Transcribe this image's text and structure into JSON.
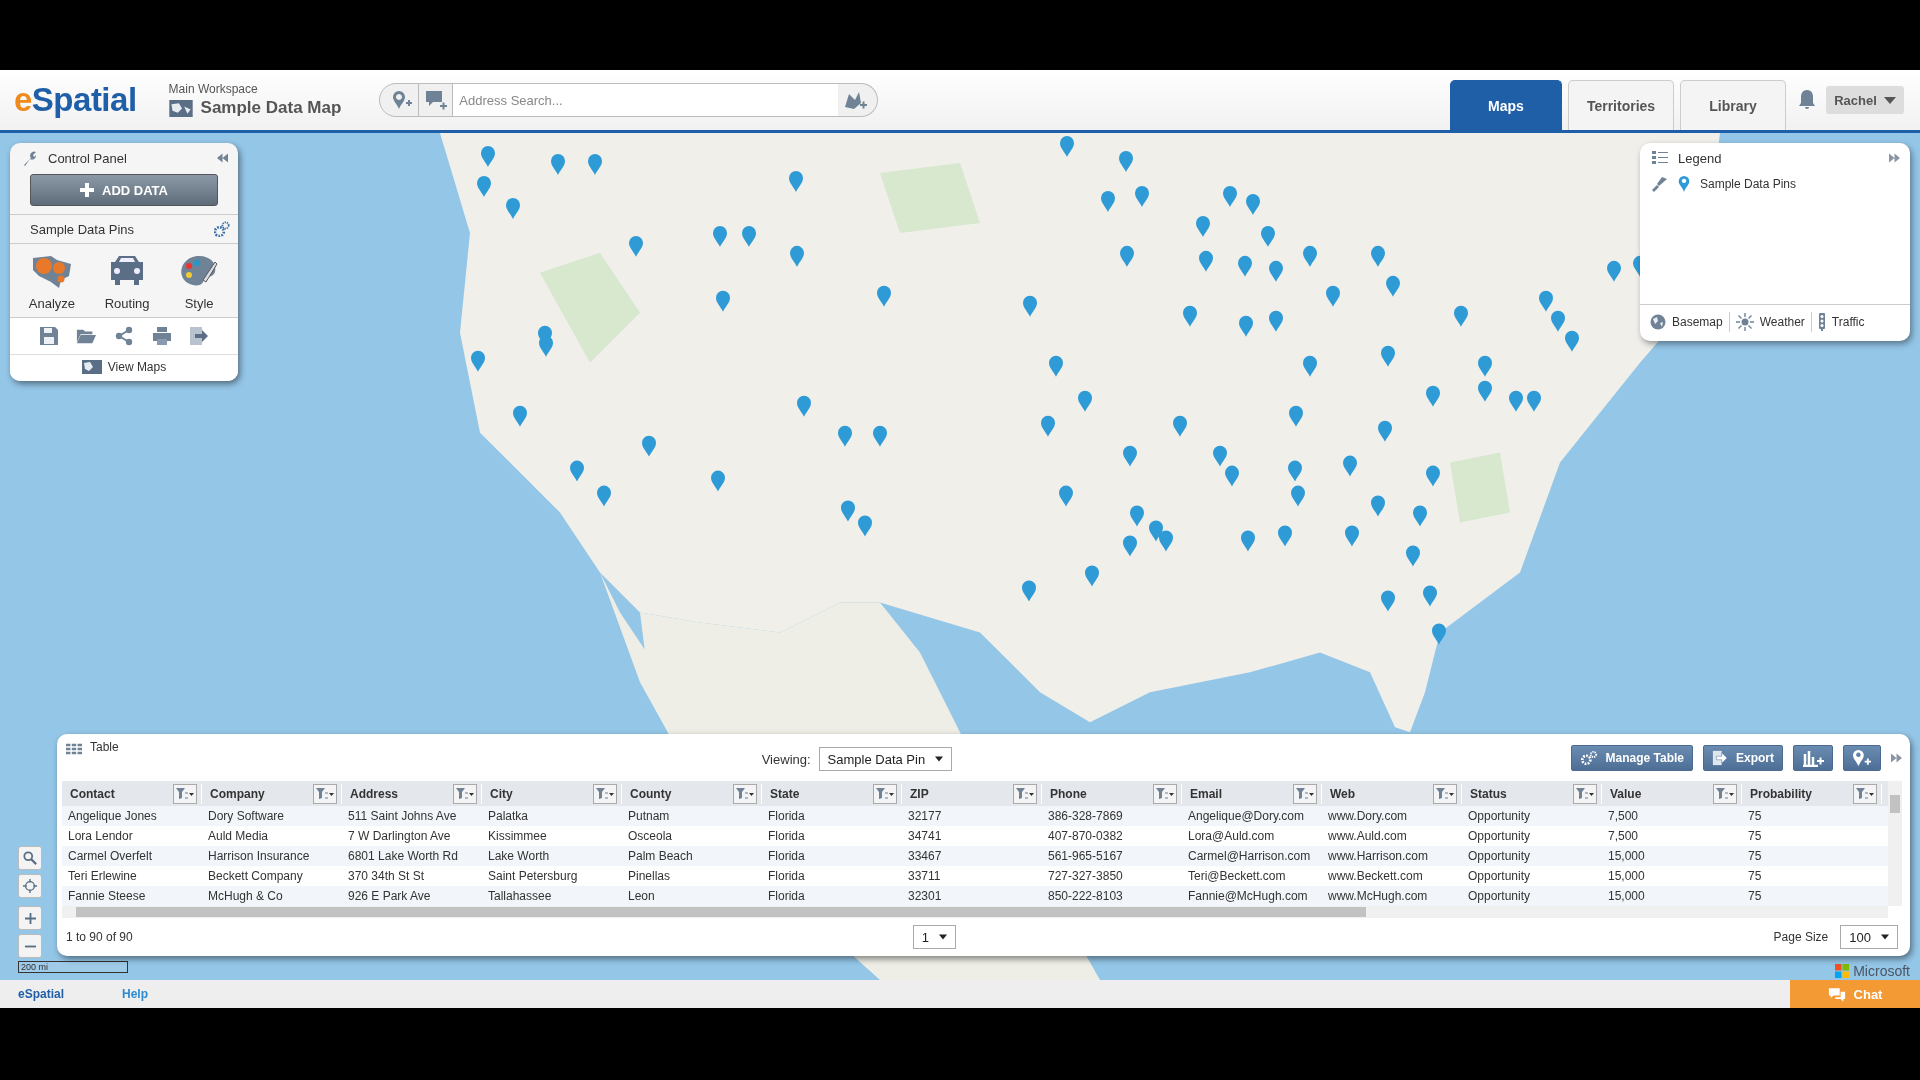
{
  "app": {
    "logo_accent": "e",
    "logo_rest": "Spatial",
    "workspace": "Main Workspace",
    "map_title": "Sample Data Map"
  },
  "search": {
    "placeholder": "Address Search..."
  },
  "tabs": [
    {
      "label": "Maps",
      "selected": true
    },
    {
      "label": "Territories",
      "selected": false
    },
    {
      "label": "Library",
      "selected": false
    }
  ],
  "user": {
    "name": "Rachel"
  },
  "control_panel": {
    "title": "Control Panel",
    "add_button": "ADD DATA",
    "layer": "Sample Data Pins",
    "tools": [
      {
        "label": "Analyze",
        "kind": "analyze"
      },
      {
        "label": "Routing",
        "kind": "routing"
      },
      {
        "label": "Style",
        "kind": "style"
      }
    ],
    "view_maps": "View Maps"
  },
  "legend": {
    "title": "Legend",
    "items": [
      {
        "label": "Sample Data Pins"
      }
    ],
    "buttons": [
      {
        "label": "Basemap",
        "kind": "basemap"
      },
      {
        "label": "Weather",
        "kind": "weather"
      },
      {
        "label": "Traffic",
        "kind": "traffic"
      }
    ]
  },
  "map": {
    "scale": "200 mi",
    "attribution": "Microsoft"
  },
  "table": {
    "title": "Table",
    "viewing_label": "Viewing:",
    "viewing": "Sample Data Pin",
    "actions": [
      {
        "label": "Manage Table",
        "kind": "manage"
      },
      {
        "label": "Export",
        "kind": "export"
      },
      {
        "kind": "chart"
      },
      {
        "kind": "pin"
      }
    ],
    "columns": [
      "Contact",
      "Company",
      "Address",
      "City",
      "County",
      "State",
      "ZIP",
      "Phone",
      "Email",
      "Web",
      "Status",
      "Value",
      "Probability"
    ],
    "rows": [
      [
        "Angelique Jones",
        "Dory Software",
        "511 Saint Johns Ave",
        "Palatka",
        "Putnam",
        "Florida",
        "32177",
        "386-328-7869",
        "Angelique@Dory.com",
        "www.Dory.com",
        "Opportunity",
        "7,500",
        "75"
      ],
      [
        "Lora Lendor",
        "Auld Media",
        "7 W Darlington Ave",
        "Kissimmee",
        "Osceola",
        "Florida",
        "34741",
        "407-870-0382",
        "Lora@Auld.com",
        "www.Auld.com",
        "Opportunity",
        "7,500",
        "75"
      ],
      [
        "Carmel Overfelt",
        "Harrison Insurance",
        "6801 Lake Worth Rd",
        "Lake Worth",
        "Palm Beach",
        "Florida",
        "33467",
        "561-965-5167",
        "Carmel@Harrison.com",
        "www.Harrison.com",
        "Opportunity",
        "15,000",
        "75"
      ],
      [
        "Teri Erlewine",
        "Beckett Company",
        "370 34th St St",
        "Saint Petersburg",
        "Pinellas",
        "Florida",
        "33711",
        "727-327-3850",
        "Teri@Beckett.com",
        "www.Beckett.com",
        "Opportunity",
        "15,000",
        "75"
      ],
      [
        "Fannie Steese",
        "McHugh & Co",
        "926 E Park Ave",
        "Tallahassee",
        "Leon",
        "Florida",
        "32301",
        "850-222-8103",
        "Fannie@McHugh.com",
        "www.McHugh.com",
        "Opportunity",
        "15,000",
        "75"
      ]
    ],
    "count": "1 to 90 of 90",
    "page": "1",
    "page_size_label": "Page Size",
    "page_size": "100"
  },
  "footer": {
    "logo": "eSpatial",
    "help": "Help",
    "chat": "Chat"
  }
}
